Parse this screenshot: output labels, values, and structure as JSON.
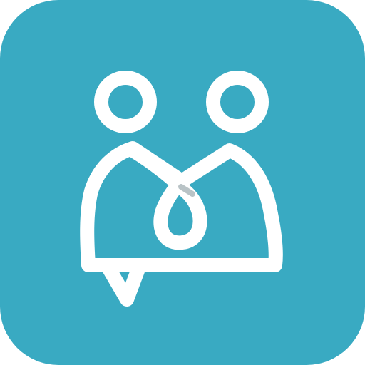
{
  "icon": {
    "name": "app-icon",
    "depicts": "two-people-chat-bubble-logo",
    "colors": {
      "background": "#39AAC2",
      "foreground": "#FFFFFF",
      "accent": "#B9C3C6"
    }
  }
}
